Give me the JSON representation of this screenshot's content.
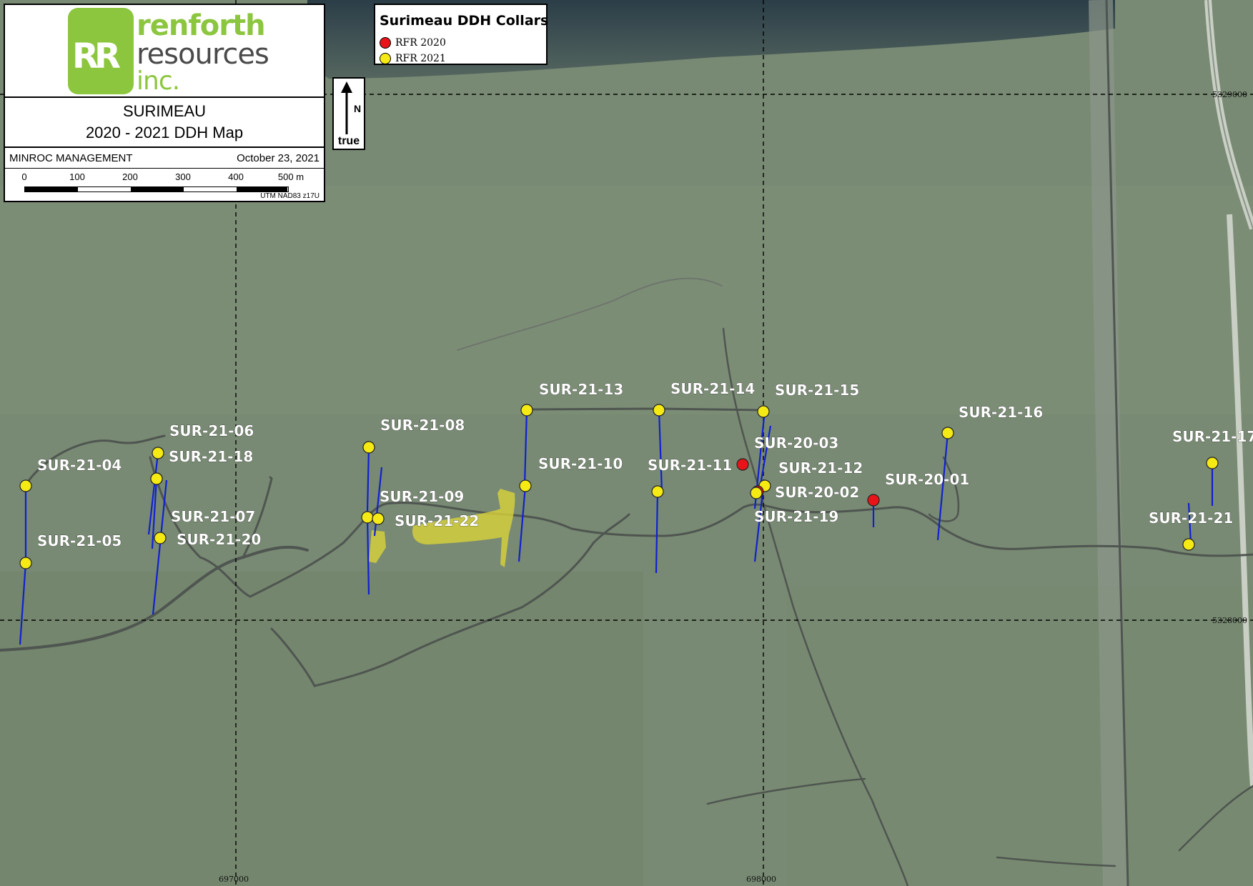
{
  "title_block": {
    "logo_initials": "RR",
    "logo_line_1": "renforth",
    "logo_line_2": "resources",
    "logo_line_3": "inc.",
    "map_title_line_1": "SURIMEAU",
    "map_title_line_2": "2020 - 2021 DDH Map",
    "company": "MINROC MANAGEMENT",
    "date": "October 23, 2021",
    "scale_labels": [
      "0",
      "100",
      "200",
      "300",
      "400",
      "500 m"
    ],
    "projection": "UTM NAD83 z17U"
  },
  "north_arrow": {
    "letter": "N",
    "label": "true"
  },
  "legend": {
    "title": "Surimeau DDH Collars",
    "items": [
      {
        "label": "RFR 2020",
        "color": "#e8141a"
      },
      {
        "label": "RFR 2021",
        "color": "#f5ea14"
      }
    ]
  },
  "grid": {
    "eastings": [
      "697000",
      "698000"
    ],
    "northings": [
      "5329000",
      "5328000"
    ]
  },
  "collars": [
    {
      "id": "SUR-21-04",
      "year": 2021
    },
    {
      "id": "SUR-21-05",
      "year": 2021
    },
    {
      "id": "SUR-21-06",
      "year": 2021
    },
    {
      "id": "SUR-21-18",
      "year": 2021
    },
    {
      "id": "SUR-21-07",
      "year": 2021
    },
    {
      "id": "SUR-21-20",
      "year": 2021
    },
    {
      "id": "SUR-21-08",
      "year": 2021
    },
    {
      "id": "SUR-21-09",
      "year": 2021
    },
    {
      "id": "SUR-21-22",
      "year": 2021
    },
    {
      "id": "SUR-21-13",
      "year": 2021
    },
    {
      "id": "SUR-21-10",
      "year": 2021
    },
    {
      "id": "SUR-21-14",
      "year": 2021
    },
    {
      "id": "SUR-21-11",
      "year": 2021
    },
    {
      "id": "SUR-21-15",
      "year": 2021
    },
    {
      "id": "SUR-20-03",
      "year": 2020
    },
    {
      "id": "SUR-21-12",
      "year": 2021
    },
    {
      "id": "SUR-20-02",
      "year": 2020
    },
    {
      "id": "SUR-21-19",
      "year": 2021
    },
    {
      "id": "SUR-20-01",
      "year": 2020
    },
    {
      "id": "SUR-21-16",
      "year": 2021
    },
    {
      "id": "SUR-21-17",
      "year": 2021
    },
    {
      "id": "SUR-21-21",
      "year": 2021
    }
  ],
  "colors": {
    "collar_2020": "#e8141a",
    "collar_2021": "#f5ea14",
    "drill_trace": "#1020d0",
    "road": "#4f5550",
    "outcrop": "#d8d23a",
    "logo_green": "#8cc63f"
  }
}
